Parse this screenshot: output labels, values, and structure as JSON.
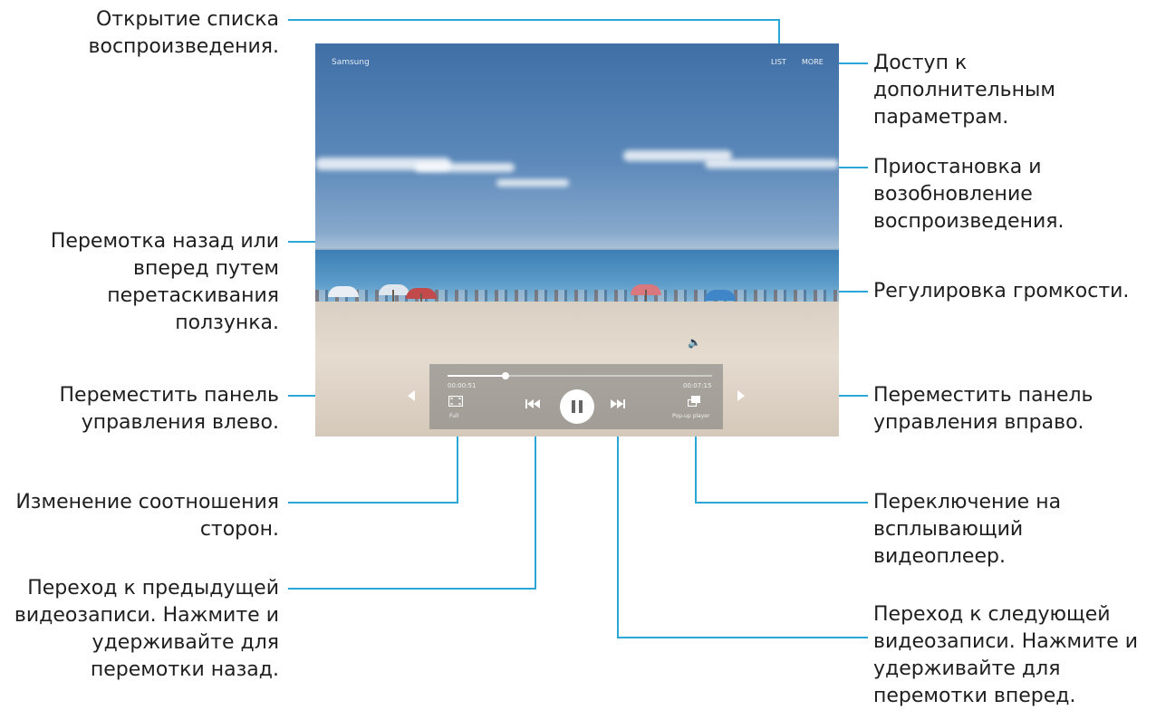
{
  "callouts": {
    "open_playlist": "Открытие списка\nвоспроизведения.",
    "more_options": "Доступ к дополнительным\nпараметрам.",
    "pause_resume": "Приостановка и\nвозобновление\nвоспроизведения.",
    "seek": "Перемотка назад или\nвперед путем\nперетаскивания ползунка.",
    "volume": "Регулировка громкости.",
    "move_panel_left": "Переместить панель\nуправления влево.",
    "move_panel_right": "Переместить панель\nуправления вправо.",
    "aspect_ratio": "Изменение соотношения\nсторон.",
    "popup_player": "Переключение на\nвсплывающий\nвидеоплеер.",
    "previous_video": "Переход к предыдущей\nвидеозаписи. Нажмите и\nудерживайте для\nперемотки назад.",
    "next_video": "Переход к следующей\nвидеозаписи. Нажмите и\nудерживайте для\nперемотки вперед."
  },
  "player": {
    "title": "Samsung",
    "list_label": "LIST",
    "more_label": "MORE",
    "current_time": "00:00:51",
    "total_time": "00:07:15",
    "ratio_label": "Full",
    "popup_label": "Pop-up player",
    "progress": 0.22
  },
  "icons": {
    "aspect": "aspect-ratio-icon",
    "prev": "skip-previous-icon",
    "play": "pause-icon",
    "next": "skip-next-icon",
    "popup": "popup-player-icon",
    "volume": "volume-icon",
    "left": "arrow-left-icon",
    "right": "arrow-right-icon"
  }
}
